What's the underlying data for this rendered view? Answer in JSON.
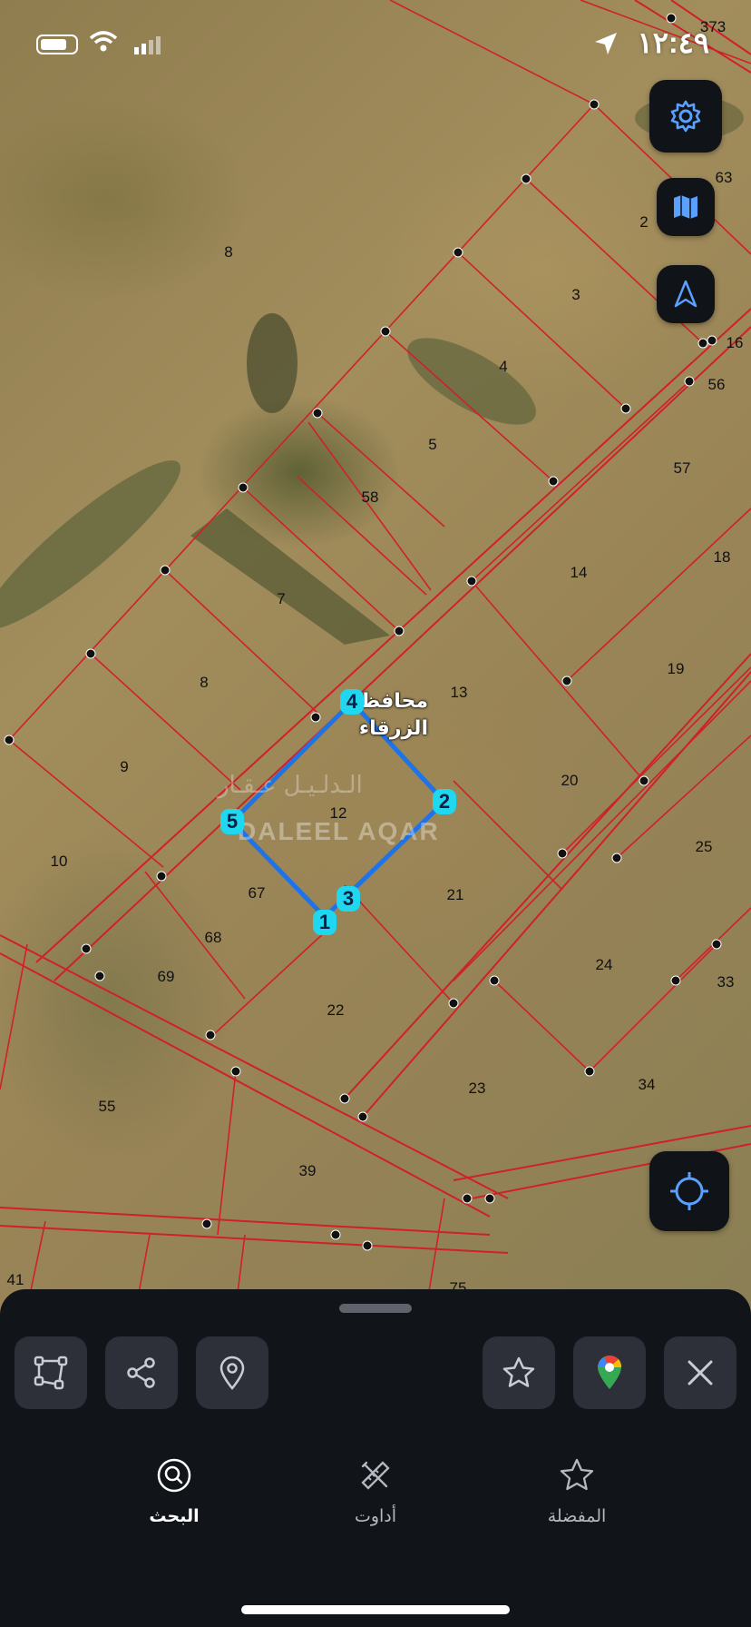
{
  "status_bar": {
    "time": "١٢:٤٩"
  },
  "map": {
    "governorate_label": "محافظة الزرقاء",
    "watermark": "DALEEL AQAR",
    "watermark_ar": "الـدلـيـل عـقـار",
    "parcel_numbers": [
      "373",
      "63",
      "2",
      "8",
      "3",
      "16",
      "4",
      "56",
      "5",
      "57",
      "58",
      "14",
      "18",
      "7",
      "19",
      "8",
      "13",
      "9",
      "12",
      "20",
      "10",
      "25",
      "67",
      "21",
      "68",
      "69",
      "24",
      "33",
      "22",
      "55",
      "23",
      "34",
      "39",
      "41",
      "75"
    ],
    "polygon_vertices": [
      "1",
      "2",
      "3",
      "4",
      "5"
    ]
  },
  "sheet": {
    "tabs": [
      {
        "label": "البحث",
        "icon": "search-icon",
        "active": true
      },
      {
        "label": "أداوت",
        "icon": "tools-icon",
        "active": false
      },
      {
        "label": "المفضلة",
        "icon": "star-icon",
        "active": false
      }
    ]
  },
  "colors": {
    "accent": "#1fd7ee",
    "polygon": "#1e73e8",
    "parcel_lines": "#d0202a",
    "sheet": "#111419"
  }
}
